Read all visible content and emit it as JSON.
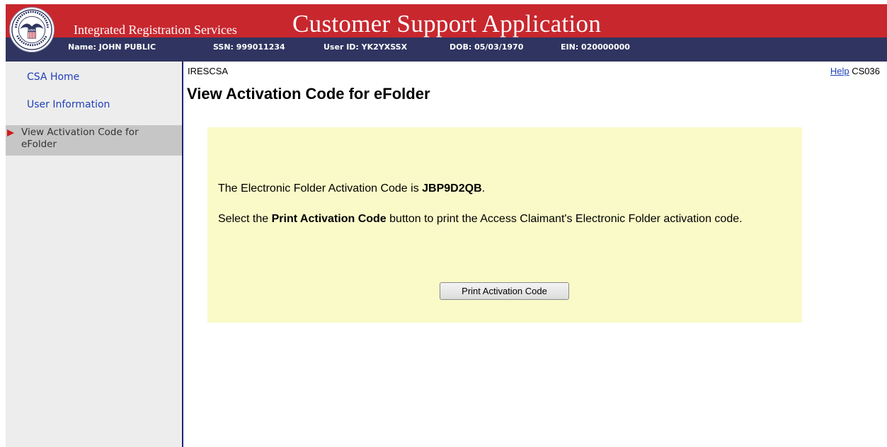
{
  "header": {
    "logo_text": "SOCIAL SECURITY ADMINISTRATION USA",
    "subtitle": "Integrated Registration Services",
    "app_title": "Customer Support Application",
    "info": {
      "name": "Name: JOHN PUBLIC",
      "ssn": "SSN: 999011234",
      "user_id": "User ID: YK2YXSSX",
      "dob": "DOB: 05/03/1970",
      "ein": "EIN: 020000000"
    }
  },
  "sidebar": {
    "items": [
      {
        "label": "CSA Home"
      },
      {
        "label": "User Information"
      },
      {
        "label": "View Activation Code for eFolder",
        "active": true
      }
    ]
  },
  "main": {
    "screen_id": "IRESCSA",
    "help_label": "Help",
    "screen_code": "CS036",
    "page_title": "View Activation Code for eFolder",
    "message1_prefix": "The Electronic Folder Activation Code is ",
    "activation_code": "JBP9D2QB",
    "message1_suffix": ".",
    "message2_prefix": "Select the ",
    "message2_bold": "Print Activation Code",
    "message2_suffix": " button to print the Access Claimant's Electronic Folder activation code.",
    "print_button_label": "Print Activation Code"
  },
  "colors": {
    "banner_red": "#c8272e",
    "infobar_navy": "#2f3560",
    "panel_yellow": "#fafac8",
    "link_blue": "#1f3fb8"
  }
}
